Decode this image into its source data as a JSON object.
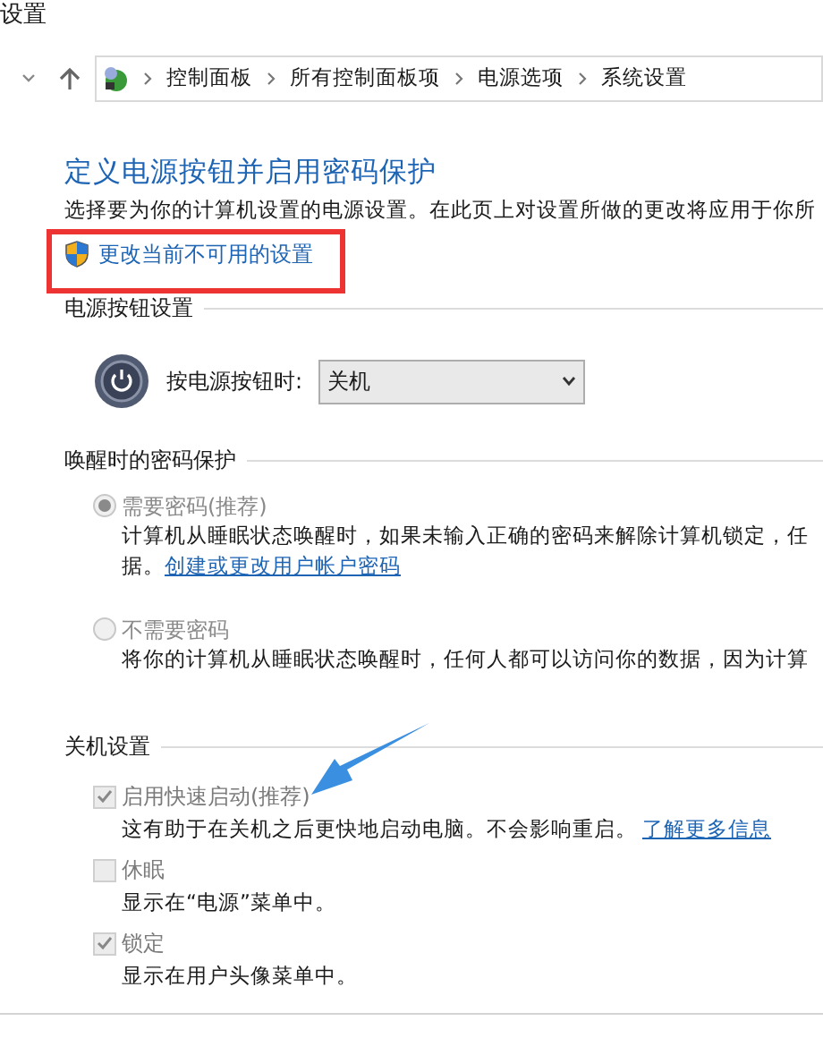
{
  "window": {
    "title": "设置"
  },
  "breadcrumb": [
    "控制面板",
    "所有控制面板项",
    "电源选项",
    "系统设置"
  ],
  "heading": "定义电源按钮并启用密码保护",
  "description": "选择要为你的计算机设置的电源设置。在此页上对设置所做的更改将应用于你所",
  "admin_link": "更改当前不可用的设置",
  "power_section": {
    "title": "电源按钮设置",
    "label": "按电源按钮时:",
    "value": "关机"
  },
  "password_section": {
    "title": "唤醒时的密码保护",
    "options": [
      {
        "label": "需要密码(推荐)",
        "selected": true,
        "disabled": true,
        "lines": [
          "计算机从睡眠状态唤醒时，如果未输入正确的密码来解除计算机锁定，任",
          "据。"
        ],
        "link": "创建或更改用户帐户密码"
      },
      {
        "label": "不需要密码",
        "selected": false,
        "disabled": true,
        "lines": [
          "将你的计算机从睡眠状态唤醒时，任何人都可以访问你的数据，因为计算"
        ]
      }
    ]
  },
  "shutdown_section": {
    "title": "关机设置",
    "options": [
      {
        "label": "启用快速启动(推荐)",
        "checked": true,
        "disabled": true,
        "description": "这有助于在关机之后更快地启动电脑。不会影响重启。",
        "link": "了解更多信息"
      },
      {
        "label": "休眠",
        "checked": false,
        "disabled": true,
        "description": "显示在“电源”菜单中。"
      },
      {
        "label": "锁定",
        "checked": true,
        "disabled": true,
        "description": "显示在用户头像菜单中。"
      }
    ]
  }
}
